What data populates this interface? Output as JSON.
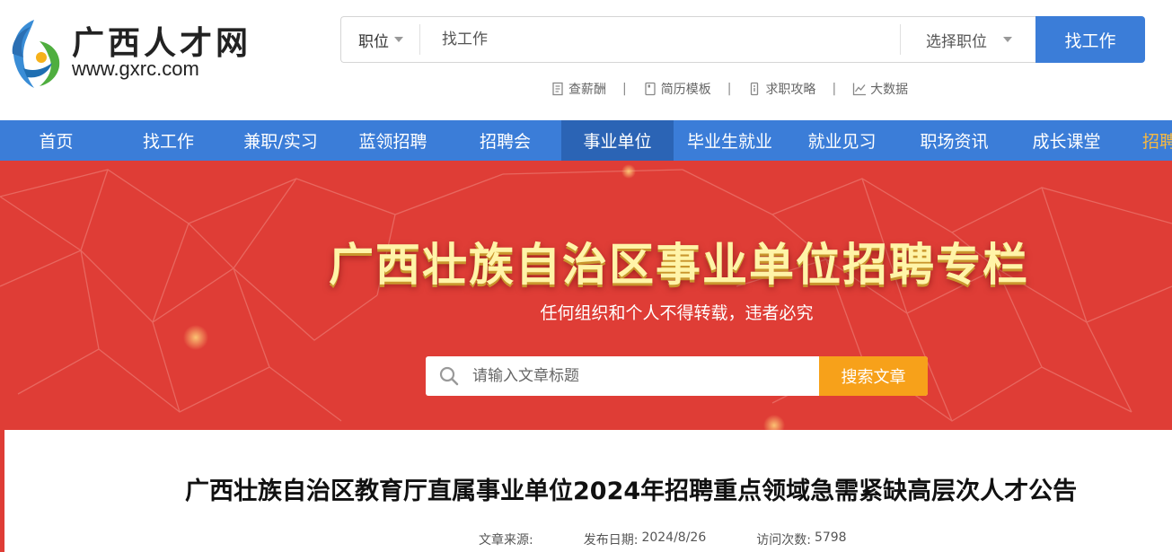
{
  "logo": {
    "name": "广西人才网",
    "url": "www.gxrc.com"
  },
  "search": {
    "type_label": "职位",
    "placeholder": "找工作",
    "select_label": "选择职位",
    "button_label": "找工作"
  },
  "quick_links": [
    {
      "label": "查薪酬",
      "icon": "salary-book-icon"
    },
    {
      "label": "简历模板",
      "icon": "resume-icon"
    },
    {
      "label": "求职攻略",
      "icon": "guide-icon"
    },
    {
      "label": "大数据",
      "icon": "chart-icon"
    }
  ],
  "quick_link_separator": "|",
  "nav": {
    "items": [
      {
        "label": "首页"
      },
      {
        "label": "找工作"
      },
      {
        "label": "兼职/实习"
      },
      {
        "label": "蓝领招聘"
      },
      {
        "label": "招聘会"
      },
      {
        "label": "事业单位",
        "active": true
      },
      {
        "label": "毕业生就业"
      },
      {
        "label": "就业见习"
      },
      {
        "label": "职场资讯"
      },
      {
        "label": "成长课堂"
      },
      {
        "label": "招聘",
        "highlight": true
      }
    ]
  },
  "banner": {
    "title": "广西壮族自治区事业单位招聘专栏",
    "subtitle": "任何组织和个人不得转载，违者必究",
    "search_placeholder": "请输入文章标题",
    "search_button": "搜索文章"
  },
  "article": {
    "title": "广西壮族自治区教育厅直属事业单位2024年招聘重点领域急需紧缺高层次人才公告",
    "source_label": "文章来源:",
    "source_value": "",
    "date_label": "发布日期:",
    "date_value": "2024/8/26",
    "visits_label": "访问次数:",
    "visits_value": "5798"
  },
  "colors": {
    "primary_blue": "#3b7dd8",
    "nav_active": "#2b64b5",
    "banner_red": "#df3d36",
    "banner_title": "#fff4a8",
    "search_orange": "#f7a11a",
    "nav_highlight": "#f5b842"
  }
}
